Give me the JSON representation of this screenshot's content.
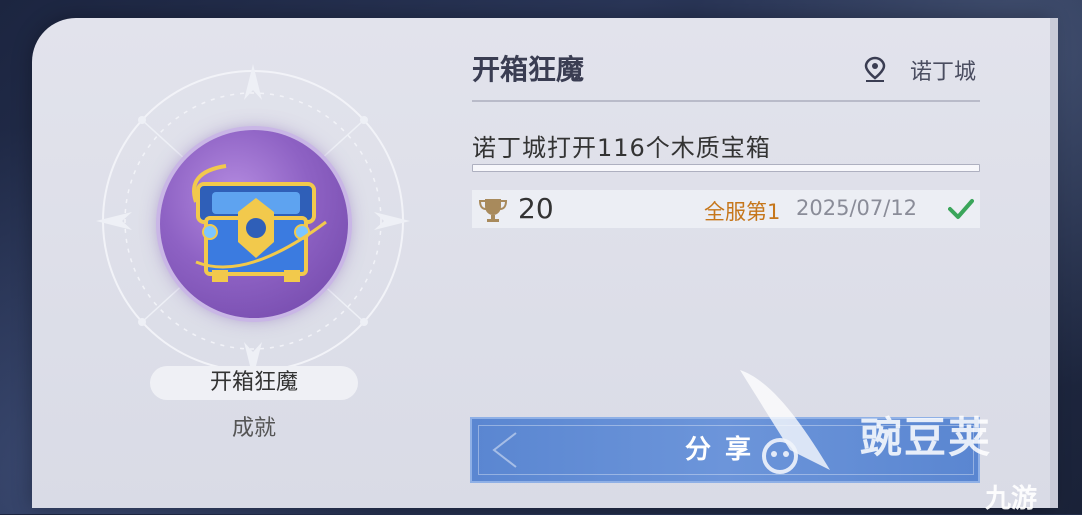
{
  "achievement": {
    "badge_name": "开箱狂魔",
    "badge_type": "成就",
    "title": "开箱狂魔",
    "location": "诺丁城",
    "description": "诺丁城打开116个木质宝箱",
    "progress": 1.0,
    "reward_value": "20",
    "rank": "全服第1",
    "date": "2025/07/12",
    "completed": true
  },
  "share_button": {
    "label": "分享"
  },
  "watermark": {
    "brand": "豌豆荚",
    "corner": "九游"
  },
  "icons": {
    "location": "location-pin-icon",
    "trophy": "trophy-icon",
    "check": "checkmark-icon",
    "chest": "treasure-chest-icon"
  },
  "colors": {
    "panel": "#dcdde7",
    "badge": "#8e62c4",
    "rank": "#c6761a",
    "check": "#3aa55a",
    "share_button": "#6389d4"
  }
}
